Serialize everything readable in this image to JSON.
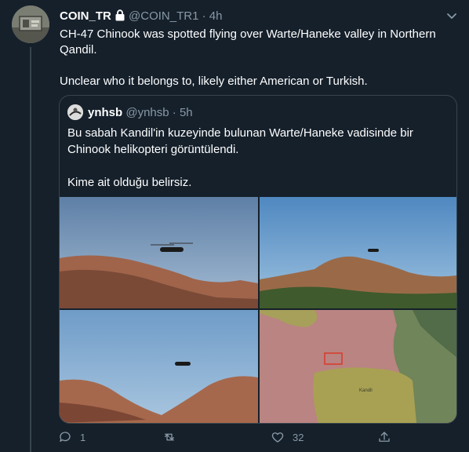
{
  "tweet": {
    "display_name": "COIN_TR",
    "handle": "@COIN_TR1",
    "separator": "·",
    "time": "4h",
    "text_line1": "CH-47 Chinook was spotted flying over Warte/Haneke valley in Northern Qandil.",
    "text_line2": "Unclear who it belongs to, likely either American or Turkish.",
    "icons": {
      "avatar": "avatar-image",
      "lock": "lock-icon",
      "more": "chevron-down-icon"
    }
  },
  "quote": {
    "display_name": "ynhsb",
    "handle": "@ynhsb",
    "separator": "·",
    "time": "5h",
    "text_line1": "Bu sabah Kandil'in kuzeyinde bulunan Warte/Haneke vadisinde bir Chinook helikopteri görüntülendi.",
    "text_line2": "Kime ait olduğu belirsiz.",
    "map_label": "Kandil"
  },
  "actions": {
    "reply_count": "1",
    "retweet_count": "",
    "like_count": "32",
    "share_count": ""
  },
  "colors": {
    "background": "#15202b",
    "border": "#38444d",
    "muted": "#8899a6"
  }
}
